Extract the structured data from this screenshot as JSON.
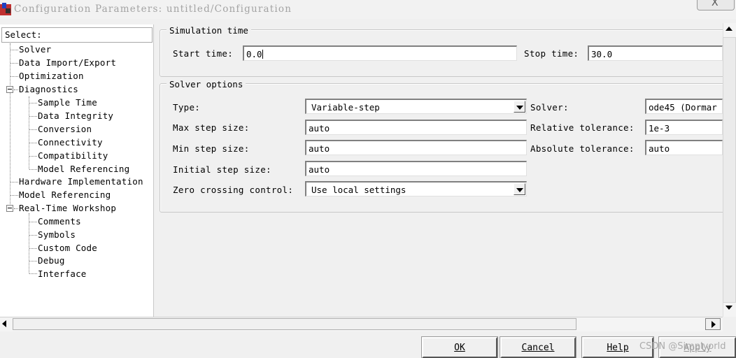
{
  "window": {
    "title": "Configuration Parameters: untitled/Configuration",
    "close_label": "X"
  },
  "tree": {
    "header": "Select:",
    "items": [
      {
        "label": "Solver"
      },
      {
        "label": "Data Import/Export"
      },
      {
        "label": "Optimization"
      },
      {
        "label": "Diagnostics"
      },
      {
        "label": "Sample Time"
      },
      {
        "label": "Data Integrity"
      },
      {
        "label": "Conversion"
      },
      {
        "label": "Connectivity"
      },
      {
        "label": "Compatibility"
      },
      {
        "label": "Model Referencing"
      },
      {
        "label": "Hardware Implementation"
      },
      {
        "label": "Model Referencing"
      },
      {
        "label": "Real-Time Workshop"
      },
      {
        "label": "Comments"
      },
      {
        "label": "Symbols"
      },
      {
        "label": "Custom Code"
      },
      {
        "label": "Debug"
      },
      {
        "label": "Interface"
      }
    ]
  },
  "simulation_time": {
    "title": "Simulation time",
    "start_label": "Start time:",
    "start_value": "0.0",
    "stop_label": "Stop time:",
    "stop_value": "30.0"
  },
  "solver_options": {
    "title": "Solver options",
    "type_label": "Type:",
    "type_value": "Variable-step",
    "solver_label": "Solver:",
    "solver_value": "ode45 (Dormar",
    "max_step_label": "Max step size:",
    "max_step_value": "auto",
    "rel_tol_label": "Relative tolerance:",
    "rel_tol_value": "1e-3",
    "min_step_label": "Min step size:",
    "min_step_value": "auto",
    "abs_tol_label": "Absolute tolerance:",
    "abs_tol_value": "auto",
    "init_step_label": "Initial step size:",
    "init_step_value": "auto",
    "zero_cross_label": "Zero crossing control:",
    "zero_cross_value": "Use local settings"
  },
  "buttons": {
    "ok": "OK",
    "cancel": "Cancel",
    "help": "Help",
    "apply": "Apply"
  },
  "watermark": "CSDN @Simplyorld"
}
